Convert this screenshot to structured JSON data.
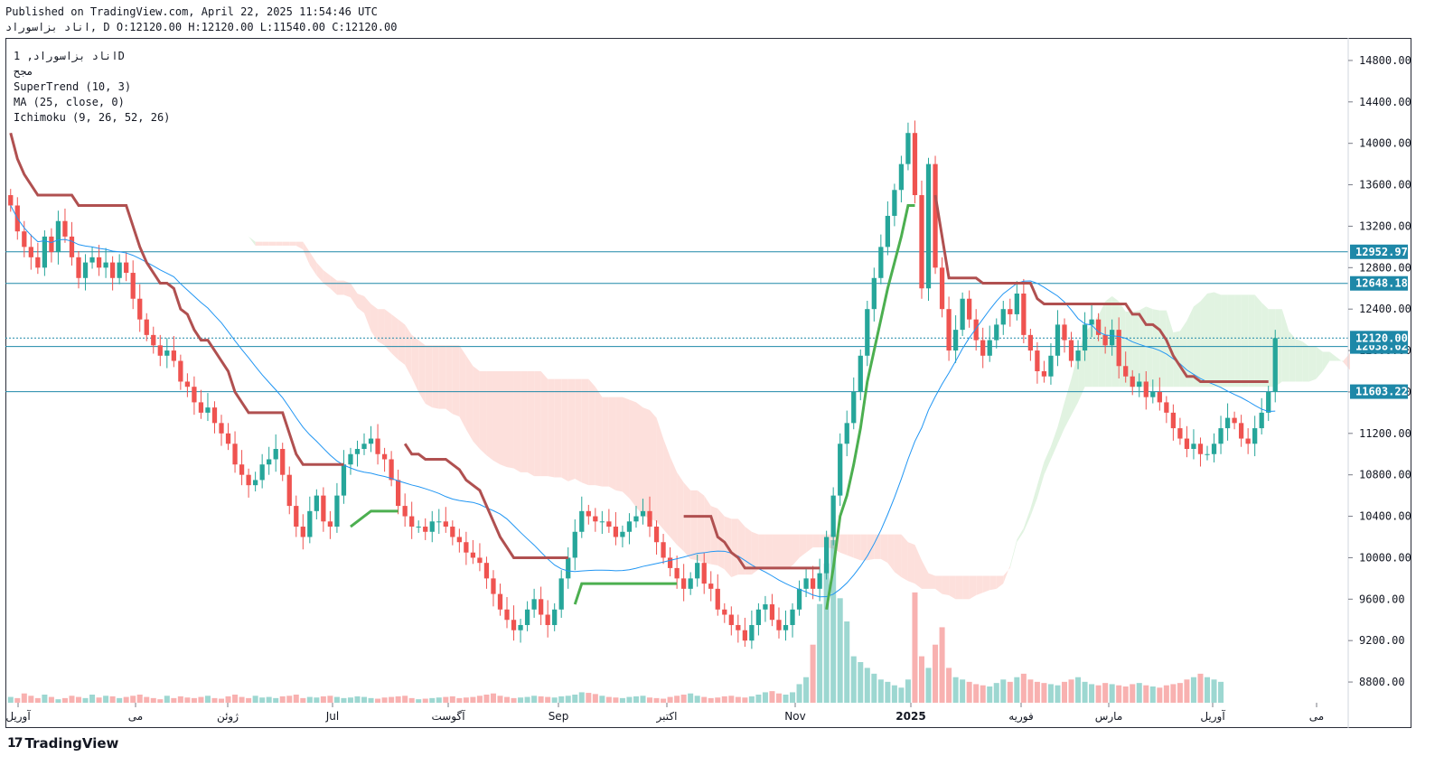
{
  "header": {
    "published": "Published on TradingView.com, April 22, 2025 11:54:46 UTC",
    "ohlc_line": "اناد بزاسوراد, D O:12120.00 H:12120.00 L:11540.00 C:12120.00"
  },
  "legend": {
    "symbol": "اناد بزاسوراد, 1D",
    "subtitle": "مجح",
    "supertrend": "SuperTrend (10, 3)",
    "ma": "MA (25, close, 0)",
    "ichimoku": "Ichimoku (9, 26, 52, 26)"
  },
  "brand": {
    "name": "TradingView",
    "icon": "tradingview-logo-icon"
  },
  "colors": {
    "up": "#26a69a",
    "down": "#ef5350",
    "supertrend_up": "#4caf50",
    "supertrend_down": "#b05050",
    "ma": "#2196f3",
    "cloud_bear": "#fde0dc",
    "cloud_bull": "#e1f3e1",
    "hline": "#1e88a8",
    "price_label": "#1e88a8"
  },
  "chart_data": {
    "type": "candlestick",
    "y_axis": {
      "ticks": [
        8800,
        9200,
        9600,
        10000,
        10400,
        10800,
        11200,
        11600,
        12000,
        12400,
        12800,
        13200,
        13600,
        14000,
        14400,
        14800
      ],
      "tick_labels": [
        "8800.00",
        "9200.00",
        "9600.00",
        "10000.00",
        "10400.00",
        "10800.00",
        "11200.00",
        "11600.00",
        "12000.00",
        "12400.00",
        "12800.00",
        "13200.00",
        "13600.00",
        "14000.00",
        "14400.00",
        "14800.00"
      ],
      "range": [
        8600,
        15000
      ]
    },
    "x_axis": {
      "labels": [
        "آوریل",
        "می",
        "ژوئن",
        "Jul",
        "آگوست",
        "Sep",
        "اکتبر",
        "Nov",
        "2025",
        "فوریه",
        "مارس",
        "آوریل",
        "می"
      ],
      "bold_label": "2025"
    },
    "horizontal_levels": [
      {
        "value": 12952.97,
        "label": "12952.97"
      },
      {
        "value": 12648.18,
        "label": "12648.18"
      },
      {
        "value": 12038.62,
        "label": "12038.62"
      },
      {
        "value": 11603.22,
        "label": "11603.22"
      }
    ],
    "last_price": {
      "value": 12120.0,
      "label": "12120.00"
    },
    "close_series": [
      13400,
      13150,
      13000,
      12900,
      12800,
      13100,
      12950,
      13250,
      13100,
      12900,
      12700,
      12850,
      12900,
      12800,
      12850,
      12700,
      12850,
      12750,
      12500,
      12300,
      12150,
      12050,
      11950,
      12000,
      11900,
      11700,
      11650,
      11500,
      11400,
      11450,
      11300,
      11200,
      11100,
      10900,
      10800,
      10700,
      10750,
      10900,
      10950,
      11050,
      10800,
      10500,
      10300,
      10200,
      10450,
      10600,
      10350,
      10300,
      10600,
      10900,
      11000,
      11050,
      11100,
      11150,
      11000,
      10950,
      10750,
      10500,
      10400,
      10300,
      10300,
      10250,
      10350,
      10350,
      10300,
      10200,
      10150,
      10050,
      10000,
      9950,
      9800,
      9650,
      9500,
      9400,
      9300,
      9350,
      9500,
      9600,
      9450,
      9350,
      9500,
      9800,
      10000,
      10250,
      10450,
      10400,
      10350,
      10350,
      10300,
      10200,
      10250,
      10350,
      10400,
      10450,
      10300,
      10150,
      10000,
      9900,
      9800,
      9700,
      9800,
      9950,
      9750,
      9700,
      9500,
      9450,
      9350,
      9300,
      9200,
      9350,
      9500,
      9550,
      9400,
      9300,
      9350,
      9500,
      9700,
      9800,
      9700,
      9850,
      10200,
      10600,
      11100,
      11300,
      11600,
      11950,
      12400,
      12700,
      13000,
      13300,
      13550,
      13800,
      14100,
      13500,
      12600,
      13800,
      12800,
      12400,
      12000,
      12200,
      12500,
      12300,
      12100,
      11950,
      12100,
      12250,
      12400,
      12350,
      12550,
      12150,
      12000,
      11800,
      11750,
      11950,
      12250,
      12100,
      11900,
      12000,
      12250,
      12300,
      12150,
      12050,
      12200,
      11850,
      11750,
      11650,
      11700,
      11550,
      11600,
      11500,
      11400,
      11250,
      11150,
      11050,
      11100,
      11000,
      11000,
      11100,
      11250,
      11350,
      11300,
      11150,
      11100,
      11250,
      11400,
      11600,
      12120
    ],
    "volume_series": [
      50,
      40,
      80,
      60,
      40,
      70,
      50,
      30,
      40,
      60,
      50,
      40,
      70,
      45,
      60,
      55,
      40,
      50,
      60,
      70,
      50,
      40,
      30,
      60,
      40,
      55,
      45,
      40,
      50,
      60,
      40,
      35,
      55,
      70,
      50,
      40,
      60,
      45,
      50,
      40,
      55,
      60,
      70,
      40,
      50,
      45,
      55,
      60,
      50,
      40,
      45,
      55,
      50,
      40,
      35,
      45,
      50,
      55,
      60,
      40,
      30,
      35,
      40,
      45,
      50,
      55,
      40,
      45,
      50,
      60,
      70,
      80,
      60,
      50,
      40,
      45,
      50,
      60,
      55,
      50,
      45,
      55,
      60,
      70,
      90,
      85,
      75,
      60,
      50,
      45,
      40,
      50,
      55,
      60,
      45,
      40,
      35,
      50,
      60,
      70,
      80,
      60,
      50,
      40,
      45,
      55,
      60,
      50,
      45,
      55,
      70,
      90,
      100,
      80,
      70,
      90,
      160,
      220,
      500,
      850,
      1200,
      1400,
      900,
      700,
      400,
      350,
      300,
      250,
      200,
      180,
      150,
      130,
      200,
      950,
      400,
      300,
      500,
      650,
      300,
      220,
      200,
      180,
      160,
      150,
      140,
      170,
      200,
      180,
      220,
      250,
      200,
      180,
      170,
      160,
      150,
      180,
      200,
      220,
      180,
      160,
      150,
      170,
      160,
      150,
      140,
      160,
      170,
      150,
      140,
      130,
      150,
      160,
      170,
      200,
      220,
      250,
      220,
      200,
      180
    ]
  }
}
